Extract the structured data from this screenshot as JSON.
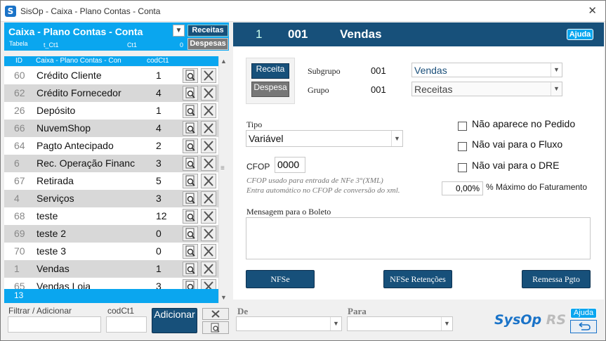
{
  "window": {
    "title": "SisOp - Caixa - Plano Contas - Conta",
    "close_glyph": "✕"
  },
  "left_header": {
    "title": "Caixa - Plano Contas - Conta",
    "table_label": "Tabela",
    "table_name": "t_Ct1",
    "ct_label": "Ct1",
    "ct_value": "0",
    "btn_receitas": "Receitas",
    "btn_despesas": "Despesas"
  },
  "grid": {
    "columns": [
      "ID",
      "Caixa - Plano Contas - Con",
      "codCt1"
    ],
    "rows": [
      {
        "id": "60",
        "name": "Crédito Cliente",
        "cod": "1"
      },
      {
        "id": "62",
        "name": "Crédito Fornecedor",
        "cod": "4"
      },
      {
        "id": "26",
        "name": "Depósito",
        "cod": "1"
      },
      {
        "id": "66",
        "name": "NuvemShop",
        "cod": "4"
      },
      {
        "id": "64",
        "name": "Pagto Antecipado",
        "cod": "2"
      },
      {
        "id": "6",
        "name": "Rec. Operação Financ",
        "cod": "3"
      },
      {
        "id": "67",
        "name": "Retirada",
        "cod": "5"
      },
      {
        "id": "4",
        "name": "Serviços",
        "cod": "3"
      },
      {
        "id": "68",
        "name": "teste",
        "cod": "12"
      },
      {
        "id": "69",
        "name": "teste 2",
        "cod": "0"
      },
      {
        "id": "70",
        "name": "teste 3",
        "cod": "0"
      },
      {
        "id": "1",
        "name": "Vendas",
        "cod": "1"
      },
      {
        "id": "65",
        "name": "Vendas Loja",
        "cod": "3"
      }
    ],
    "count": "13"
  },
  "filter": {
    "filter_label": "Filtrar / Adicionar",
    "cod_label": "codCt1",
    "add_button": "Adicionar",
    "de_label": "De",
    "para_label": "Para"
  },
  "detail": {
    "num": "1",
    "code": "001",
    "name": "Vendas",
    "help": "Ajuda",
    "btn_receita": "Receita",
    "btn_despesa": "Despesa",
    "subgrupo_label": "Subgrupo",
    "subgrupo_code": "001",
    "subgrupo_value": "Vendas",
    "grupo_label": "Grupo",
    "grupo_code": "001",
    "grupo_value": "Receitas",
    "tipo_label": "Tipo",
    "tipo_value": "Variável",
    "cfop_label": "CFOP",
    "cfop_value": "0000",
    "cfop_hint1": "CFOP usado para entrada de NFe 3°(XML)",
    "cfop_hint2": "Entra automático no CFOP de conversão do xml.",
    "chk_pedido": "Não aparece no Pedido",
    "chk_fluxo": "Não vai para o Fluxo",
    "chk_dre": "Não vai para o DRE",
    "pct_value": "0,00%",
    "pct_label": "% Máximo do Faturamento",
    "msg_label": "Mensagem para o Boleto",
    "btn_nfse": "NFSe",
    "btn_nfse_ret": "NFSe Retenções",
    "btn_remessa": "Remessa Pgto"
  },
  "footer": {
    "logo": "SysOp",
    "logo_suffix": "RS",
    "help": "Ajuda"
  }
}
